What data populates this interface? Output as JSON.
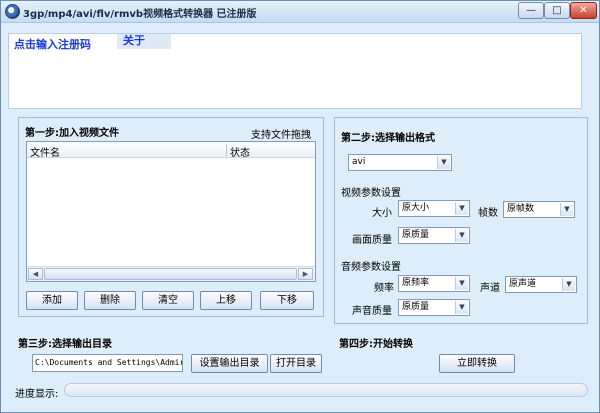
{
  "window": {
    "title": "3gp/mp4/avi/flv/rmvb视频格式转换器  已注册版",
    "min_symbol": "—",
    "max_symbol": "□",
    "close_symbol": "✕"
  },
  "registration": {
    "link_label": "点击输入注册码",
    "about_label": "关于"
  },
  "step1": {
    "title": "第一步:加入视频文件",
    "drag_hint": "支持文件拖拽",
    "columns": [
      "文件名",
      "状态"
    ],
    "scroll_left": "◀",
    "scroll_right": "▶",
    "buttons": {
      "add": "添加",
      "delete": "删除",
      "clear": "清空",
      "move_up": "上移",
      "move_down": "下移"
    }
  },
  "step2": {
    "title": "第二步:选择输出格式",
    "format_value": "avi",
    "video_section": "视频参数设置",
    "size_label": "大小",
    "size_value": "原大小",
    "fps_label": "帧数",
    "fps_value": "原帧数",
    "picture_quality_label": "画面质量",
    "picture_quality_value": "原质量",
    "audio_section": "音频参数设置",
    "sample_rate_label": "频率",
    "sample_rate_value": "原频率",
    "channel_label": "声道",
    "channel_value": "原声道",
    "audio_quality_label": "声音质量",
    "audio_quality_value": "原质量",
    "dropdown_arrow": "▼"
  },
  "step3": {
    "title": "第三步:选择输出目录",
    "path_value": "C:\\Documents and Settings\\Admir",
    "set_dir_button": "设置输出目录",
    "open_dir_button": "打开目录"
  },
  "step4": {
    "title": "第四步:开始转换",
    "convert_button": "立即转换"
  },
  "progress": {
    "label": "进度显示:",
    "value": 0
  }
}
